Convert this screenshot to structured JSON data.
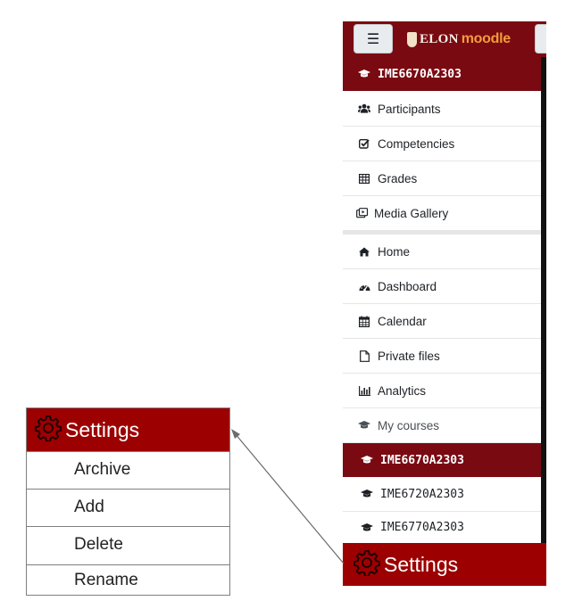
{
  "header": {
    "menu_icon": "hamburger-icon",
    "logo_text": "ELON",
    "logo_product": "moodle"
  },
  "course_nav": {
    "current_course": "IME6670A2303",
    "items": [
      {
        "label": "Participants",
        "icon": "users-icon"
      },
      {
        "label": "Competencies",
        "icon": "checkbox-icon"
      },
      {
        "label": "Grades",
        "icon": "table-icon"
      },
      {
        "label": "Media Gallery",
        "icon": "media-icon"
      }
    ]
  },
  "site_nav": {
    "items": [
      {
        "label": "Home",
        "icon": "home-icon"
      },
      {
        "label": "Dashboard",
        "icon": "dashboard-icon"
      },
      {
        "label": "Calendar",
        "icon": "calendar-icon"
      },
      {
        "label": "Private files",
        "icon": "file-icon"
      },
      {
        "label": "Analytics",
        "icon": "chart-icon"
      },
      {
        "label": "My courses",
        "icon": "graduation-cap-icon"
      }
    ]
  },
  "my_courses": [
    {
      "label": "IME6670A2303",
      "active": true
    },
    {
      "label": "IME6720A2303",
      "active": false
    },
    {
      "label": "IME6770A2303",
      "active": false
    }
  ],
  "settings_bar": {
    "label": "Settings",
    "icon": "gear-icon"
  },
  "settings_menu": {
    "title": "Settings",
    "items": [
      "Archive",
      "Add",
      "Delete",
      "Rename"
    ]
  },
  "colors": {
    "brand_dark": "#7a0a12",
    "settings_red": "#9c0000"
  }
}
